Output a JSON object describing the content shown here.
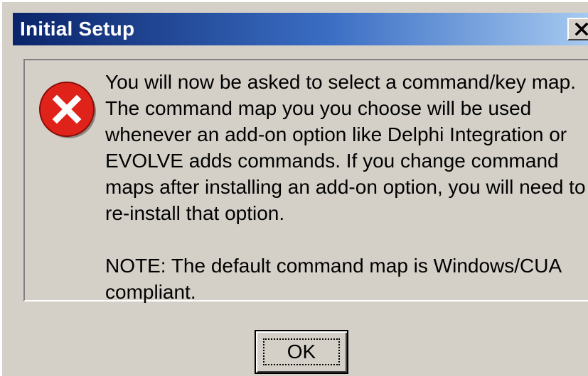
{
  "window": {
    "title": "Initial Setup",
    "close_glyph": "✕",
    "titlebar_color": "#0a246a",
    "face_color": "#d4d0c8"
  },
  "message": {
    "icon": "error-icon",
    "icon_color": "#e0231a",
    "body": "You will now be asked to select a command/key map.  The command map you you choose will be used whenever an add-on option like Delphi Integration or EVOLVE adds commands.  If you change command maps after installing an add-on option, you will need to re-install that option.",
    "note": "NOTE: The default command map is Windows/CUA compliant."
  },
  "buttons": {
    "ok_label": "OK"
  }
}
